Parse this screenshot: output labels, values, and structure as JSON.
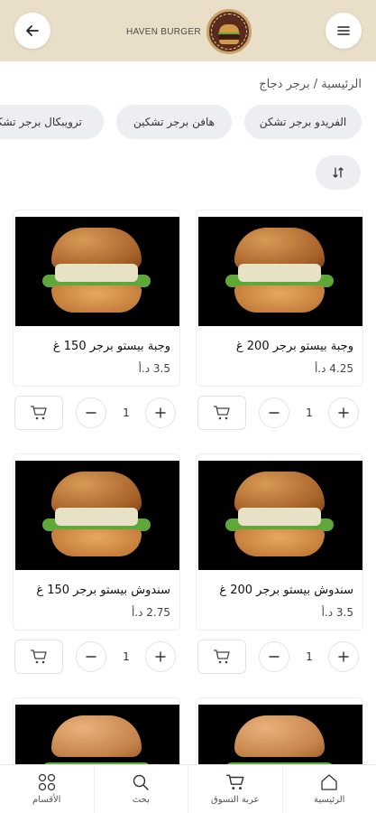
{
  "header": {
    "brand": "HAVEN BURGER",
    "back_icon": "arrow-left-icon",
    "menu_icon": "hamburger-menu-icon"
  },
  "breadcrumb": "الرئيسية / برجر دجاج",
  "categories": [
    {
      "label": "الفريدو برجر تشكن"
    },
    {
      "label": "هافن برجر تشكين"
    },
    {
      "label": "ترويبكال برجر تشكين"
    }
  ],
  "sort_icon": "sort-icon",
  "products": [
    {
      "name": "وجبة بيستو برجر 200 غ",
      "price": "4.25 د.أ",
      "qty": "1"
    },
    {
      "name": "وجبة بيستو برجر 150 غ",
      "price": "3.5 د.أ",
      "qty": "1"
    },
    {
      "name": "سندوش بيستو برجر 200 غ",
      "price": "3.5 د.أ",
      "qty": "1"
    },
    {
      "name": "سندوش بيستو برجر 150 غ",
      "price": "2.75 د.أ",
      "qty": "1"
    }
  ],
  "tabs": [
    {
      "label": "الرئيسية",
      "icon": "home-icon"
    },
    {
      "label": "عربة التسوق",
      "icon": "cart-icon"
    },
    {
      "label": "بحث",
      "icon": "search-icon"
    },
    {
      "label": "الأقسام",
      "icon": "grid-icon"
    }
  ],
  "colors": {
    "header_bg": "#e9dfc9",
    "chip_bg": "#eceef1"
  }
}
